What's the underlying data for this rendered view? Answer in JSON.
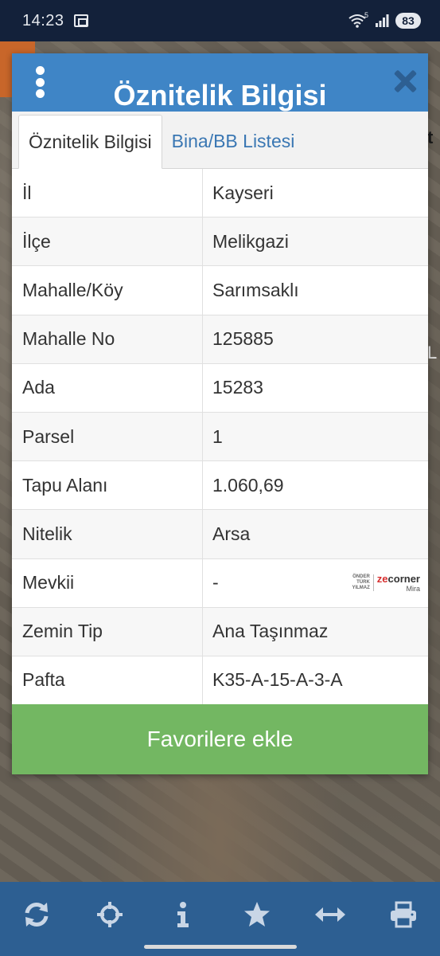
{
  "status_bar": {
    "time": "14:23",
    "battery": "83",
    "wifi_badge": "5"
  },
  "dialog": {
    "title": "Öznitelik Bilgisi",
    "tabs": [
      {
        "label": "Öznitelik Bilgisi",
        "active": true
      },
      {
        "label": "Bina/BB Listesi",
        "active": false
      }
    ],
    "rows": [
      {
        "key": "İl",
        "value": "Kayseri"
      },
      {
        "key": "İlçe",
        "value": "Melikgazi"
      },
      {
        "key": "Mahalle/Köy",
        "value": "Sarımsaklı"
      },
      {
        "key": "Mahalle No",
        "value": "125885"
      },
      {
        "key": "Ada",
        "value": "15283"
      },
      {
        "key": "Parsel",
        "value": "1"
      },
      {
        "key": "Tapu Alanı",
        "value": "1.060,69"
      },
      {
        "key": "Nitelik",
        "value": "Arsa"
      },
      {
        "key": "Mevkii",
        "value": "-"
      },
      {
        "key": "Zemin Tip",
        "value": "Ana Taşınmaz"
      },
      {
        "key": "Pafta",
        "value": "K35-A-15-A-3-A"
      }
    ],
    "watermark": {
      "line1": "ÖNDER",
      "line2": "TÜRK",
      "line3": "YILMAZ",
      "brand_prefix": "ze",
      "brand_suffix": "corner",
      "sub": "Mira"
    },
    "favorite_button": "Favorilere ekle"
  },
  "map_edge": {
    "text_right": "L",
    "text_right_dark": "t"
  },
  "toolbar": {
    "icons": [
      "refresh-icon",
      "crosshair-icon",
      "info-icon",
      "star-icon",
      "measure-icon",
      "print-icon"
    ]
  },
  "colors": {
    "header_blue": "#3f85c6",
    "toolbar_blue": "#2d5f92",
    "status_bar": "#13213a",
    "favorite_green": "#73b762",
    "tab_link": "#3a77b3"
  }
}
